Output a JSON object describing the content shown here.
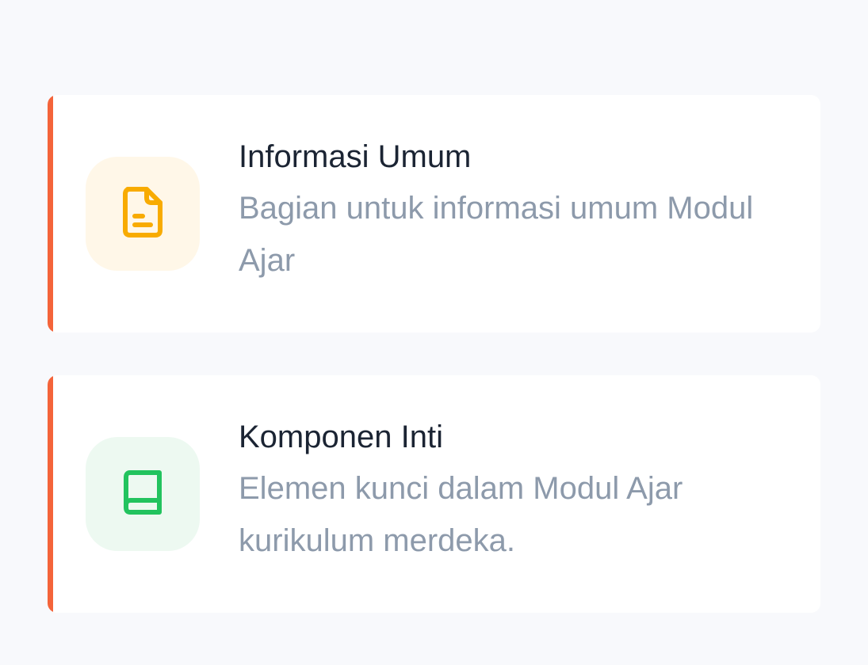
{
  "cards": [
    {
      "title": "Informasi Umum",
      "description": "Bagian untuk informasi umum Modul Ajar",
      "icon": "file-text-icon",
      "icon_color": "#f8ab00",
      "icon_bg": "#fff7e8"
    },
    {
      "title": "Komponen Inti",
      "description": "Elemen kunci dalam Modul Ajar kurikulum merdeka.",
      "icon": "book-icon",
      "icon_color": "#22c35e",
      "icon_bg": "#edf9f1"
    }
  ],
  "accent_color": "#f4643a"
}
